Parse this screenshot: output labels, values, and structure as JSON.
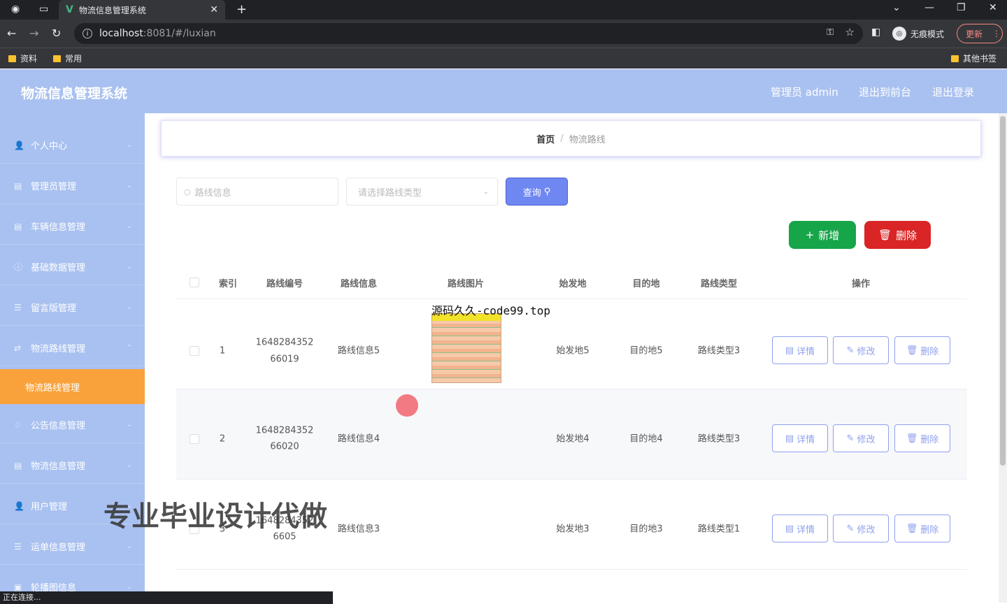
{
  "browser": {
    "tab_title": "物流信息管理系统",
    "url_host": "localhost",
    "url_path": ":8081/#/luxian",
    "incognito_label": "无痕模式",
    "update_label": "更新",
    "bookmarks": [
      "资料",
      "常用"
    ],
    "other_bookmarks": "其他书签",
    "status_text": "正在连接..."
  },
  "header": {
    "title": "物流信息管理系统",
    "user": "管理员 admin",
    "back_front": "退出到前台",
    "logout": "退出登录"
  },
  "sidebar": {
    "items": [
      {
        "label": "个人中心"
      },
      {
        "label": "管理员管理"
      },
      {
        "label": "车辆信息管理"
      },
      {
        "label": "基础数据管理"
      },
      {
        "label": "留言版管理"
      },
      {
        "label": "物流路线管理"
      },
      {
        "label": "物流路线管理"
      },
      {
        "label": "公告信息管理"
      },
      {
        "label": "物流信息管理"
      },
      {
        "label": "用户管理"
      },
      {
        "label": "运单信息管理"
      },
      {
        "label": "轮播图信息"
      }
    ]
  },
  "breadcrumb": {
    "home": "首页",
    "separator": "/",
    "current": "物流路线"
  },
  "search": {
    "placeholder": "路线信息",
    "select_placeholder": "请选择路线类型",
    "query_label": "查询"
  },
  "actions": {
    "add_label": "新增",
    "delete_label": "删除"
  },
  "table": {
    "headers": [
      "索引",
      "路线编号",
      "路线信息",
      "路线图片",
      "始发地",
      "目的地",
      "路线类型",
      "操作"
    ],
    "rows": [
      {
        "index": "1",
        "code_line1": "1648284352",
        "code_line2": "66019",
        "info": "路线信息5",
        "origin": "始发地5",
        "dest": "目的地5",
        "type": "路线类型3"
      },
      {
        "index": "2",
        "code_line1": "1648284352",
        "code_line2": "66020",
        "info": "路线信息4",
        "origin": "始发地4",
        "dest": "目的地4",
        "type": "路线类型3"
      },
      {
        "index": "3",
        "code_line1": "1648284352",
        "code_line2": "6605",
        "info": "路线信息3",
        "origin": "始发地3",
        "dest": "目的地3",
        "type": "路线类型1"
      }
    ],
    "op_detail": "详情",
    "op_edit": "修改",
    "op_delete": "删除"
  },
  "overlays": {
    "image_caption": "源码久久-code99.top",
    "promo": "专业毕业设计代做"
  },
  "colors": {
    "header_bg": "#a9c1f0",
    "active_menu": "#f9a23c",
    "query_btn": "#6f87f0",
    "add_btn": "#17a54a",
    "delete_btn": "#d92525"
  }
}
